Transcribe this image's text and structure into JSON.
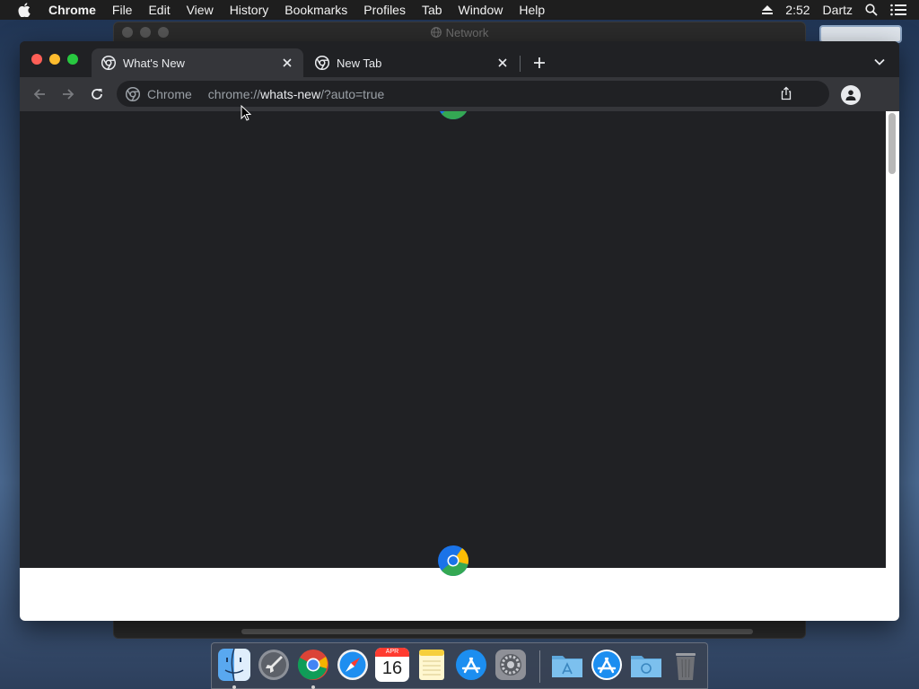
{
  "menubar": {
    "app_name": "Chrome",
    "items": [
      "File",
      "Edit",
      "View",
      "History",
      "Bookmarks",
      "Profiles",
      "Tab",
      "Window",
      "Help"
    ],
    "time": "2:52",
    "user": "Dartz",
    "icons": [
      "apple-icon",
      "eject-icon",
      "spotlight-search-icon",
      "notification-center-icon"
    ]
  },
  "background_window": {
    "title": "Network"
  },
  "chrome": {
    "traffic_lights": {
      "close": "#ff5f57",
      "minimize": "#febc2e",
      "zoom": "#28c840"
    },
    "tabs": [
      {
        "title": "What's New",
        "active": true,
        "icon": "chrome-icon"
      },
      {
        "title": "New Tab",
        "active": false,
        "icon": "chrome-icon"
      }
    ],
    "omnibox": {
      "chip": "Chrome",
      "scheme": "chrome://",
      "host": "whats-new",
      "path": "/?auto=true"
    },
    "colors": {
      "frame": "#202124",
      "toolbar": "#35363a",
      "text": "#e8eaed",
      "muted": "#9aa0a6"
    }
  },
  "dock": {
    "apps": [
      {
        "name": "Finder",
        "icon": "finder-icon",
        "running": true
      },
      {
        "name": "Launchpad",
        "icon": "launchpad-icon",
        "running": false
      },
      {
        "name": "Google Chrome",
        "icon": "chrome-icon",
        "running": true
      },
      {
        "name": "Safari",
        "icon": "safari-icon",
        "running": false
      },
      {
        "name": "Calendar",
        "icon": "calendar-icon",
        "running": false,
        "month": "APR",
        "day": "16"
      },
      {
        "name": "Notes",
        "icon": "notes-icon",
        "running": false
      },
      {
        "name": "App Store",
        "icon": "app-store-icon",
        "running": false
      },
      {
        "name": "System Preferences",
        "icon": "system-preferences-icon",
        "running": false
      },
      {
        "name": "Applications",
        "icon": "applications-folder-icon",
        "running": false
      },
      {
        "name": "App Store Download",
        "icon": "app-store-download-icon",
        "running": false
      },
      {
        "name": "Downloads",
        "icon": "downloads-folder-icon",
        "running": false
      },
      {
        "name": "Trash",
        "icon": "trash-icon",
        "running": false
      }
    ]
  }
}
